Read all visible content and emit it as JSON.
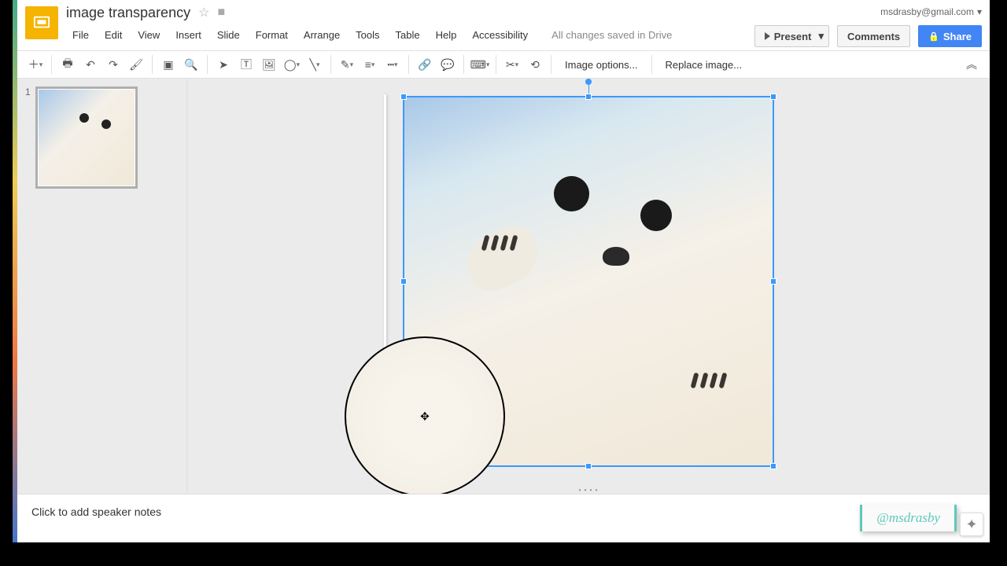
{
  "account_email": "msdrasby@gmail.com",
  "document": {
    "title": "image transparency"
  },
  "menus": {
    "file": "File",
    "edit": "Edit",
    "view": "View",
    "insert": "Insert",
    "slide": "Slide",
    "format": "Format",
    "arrange": "Arrange",
    "tools": "Tools",
    "table": "Table",
    "help": "Help",
    "accessibility": "Accessibility"
  },
  "save_status": "All changes saved in Drive",
  "buttons": {
    "present": "Present",
    "comments": "Comments",
    "share": "Share"
  },
  "toolbar": {
    "image_options": "Image options...",
    "replace_image": "Replace image..."
  },
  "thumbnails": [
    {
      "number": "1"
    }
  ],
  "notes_placeholder": "Click to add speaker notes",
  "watermark": "@msdrasby"
}
